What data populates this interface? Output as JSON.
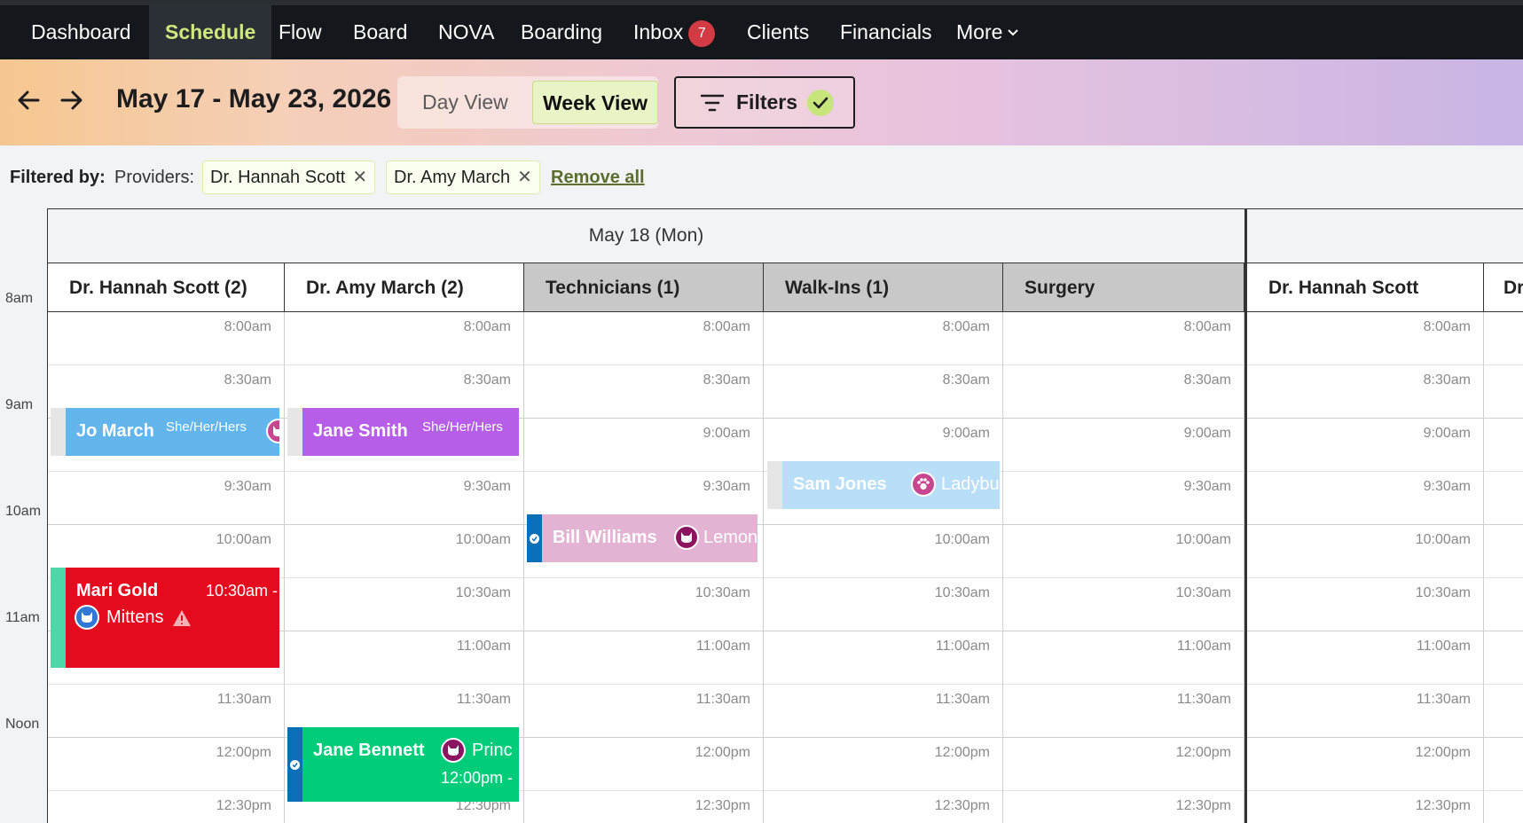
{
  "nav": {
    "items": [
      {
        "label": "Dashboard"
      },
      {
        "label": "Schedule"
      },
      {
        "label": "Flow"
      },
      {
        "label": "Board"
      },
      {
        "label": "NOVA"
      },
      {
        "label": "Boarding"
      },
      {
        "label": "Inbox",
        "badge": "7"
      },
      {
        "label": "Clients"
      },
      {
        "label": "Financials"
      },
      {
        "label": "More"
      }
    ],
    "active": "Schedule"
  },
  "header": {
    "date_range": "May 17 - May 23, 2026",
    "view_day": "Day View",
    "view_week": "Week View",
    "active_view": "Week View",
    "filters_label": "Filters"
  },
  "filter_bar": {
    "prefix": "Filtered by:",
    "group_label": "Providers:",
    "chips": [
      "Dr. Hannah Scott",
      "Dr. Amy March"
    ],
    "remove_all": "Remove all"
  },
  "time_axis": [
    "8am",
    "9am",
    "10am",
    "11am",
    "Noon"
  ],
  "day": {
    "label": "May 18 (Mon)",
    "columns": [
      "Dr. Hannah Scott (2)",
      "Dr. Amy March (2)",
      "Technicians (1)",
      "Walk-Ins (1)",
      "Surgery",
      "Dr. Hannah Scott",
      "Dr"
    ]
  },
  "slots": [
    "8:00am",
    "8:30am",
    "9:00am",
    "9:30am",
    "10:00am",
    "10:30am",
    "11:00am",
    "11:30am",
    "12:00pm",
    "12:30pm"
  ],
  "appointments": [
    {
      "client": "Jo March",
      "pronouns": "She/Her/Hers",
      "pet": "",
      "time": ""
    },
    {
      "client": "Jane Smith",
      "pronouns": "She/Her/Hers",
      "pet": "",
      "time": ""
    },
    {
      "client": "Sam Jones",
      "pronouns": "",
      "pet": "Ladybug",
      "time": ""
    },
    {
      "client": "Bill Williams",
      "pronouns": "",
      "pet": "Lemon",
      "time": ""
    },
    {
      "client": "Mari Gold",
      "pronouns": "",
      "pet": "Mittens",
      "time": "10:30am -"
    },
    {
      "client": "Jane Bennett",
      "pronouns": "",
      "pet": "Princ",
      "time": "12:00pm -"
    }
  ],
  "colors": {
    "nav_bg": "#14181c",
    "active_nav_text": "#cfe87a",
    "blue_appt": "#62b6ec",
    "purple_appt": "#b75ee8",
    "light_blue_appt": "#b9def8",
    "pink_appt": "#e3b3d4",
    "red_appt": "#e60a1f",
    "green_appt": "#00cc7a",
    "check_badge": "#c7e57a"
  }
}
